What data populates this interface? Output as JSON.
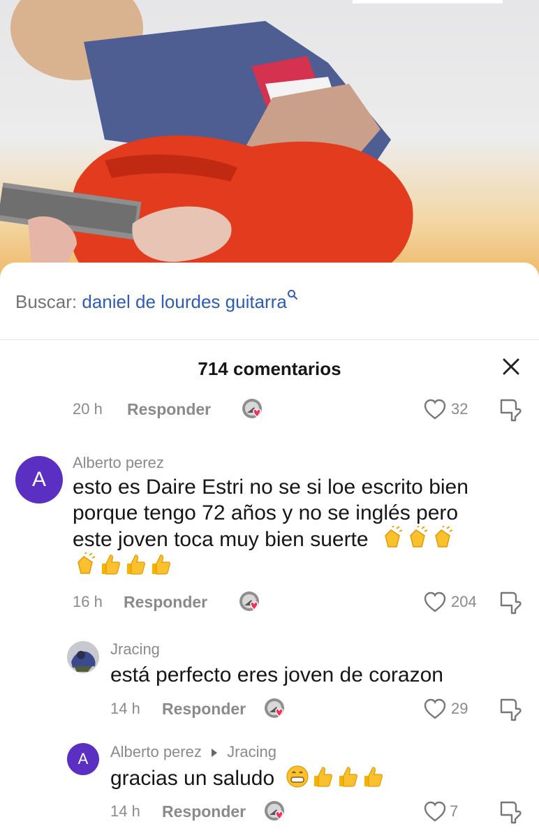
{
  "search": {
    "prefix": "Buscar:",
    "query": "daniel de lourdes guitarra"
  },
  "header": {
    "comment_count": "714 comentarios"
  },
  "reply_label": "Responder",
  "comments": [
    {
      "time": "20 h",
      "likes": "32"
    },
    {
      "author": "Alberto perez",
      "avatar_letter": "A",
      "text_line1": "esto es Daire Estri no se si loe escrito bien",
      "text_line2": "porque tengo 72 años y no se inglés pero",
      "text_line3": "este joven toca muy bien suerte",
      "time": "16 h",
      "likes": "204"
    },
    {
      "author": "Jracing",
      "text": "está perfecto eres joven de corazon",
      "time": "14 h",
      "likes": "29"
    },
    {
      "author": "Alberto perez",
      "avatar_letter": "A",
      "reply_to": "Jracing",
      "text": "gracias un saludo",
      "time": "14 h",
      "likes": "7"
    }
  ],
  "colors": {
    "accent_link": "#2c5cb4",
    "avatar": "#5a2fc2",
    "heart_badge": "#fe2c55",
    "meta_gray": "#8a8a8a"
  },
  "icons": [
    "search-icon",
    "close-icon",
    "heart-icon",
    "dislike-icon",
    "creator-liked-badge",
    "clapping-hands-emoji",
    "thumbs-up-emoji",
    "grinning-emoji"
  ]
}
